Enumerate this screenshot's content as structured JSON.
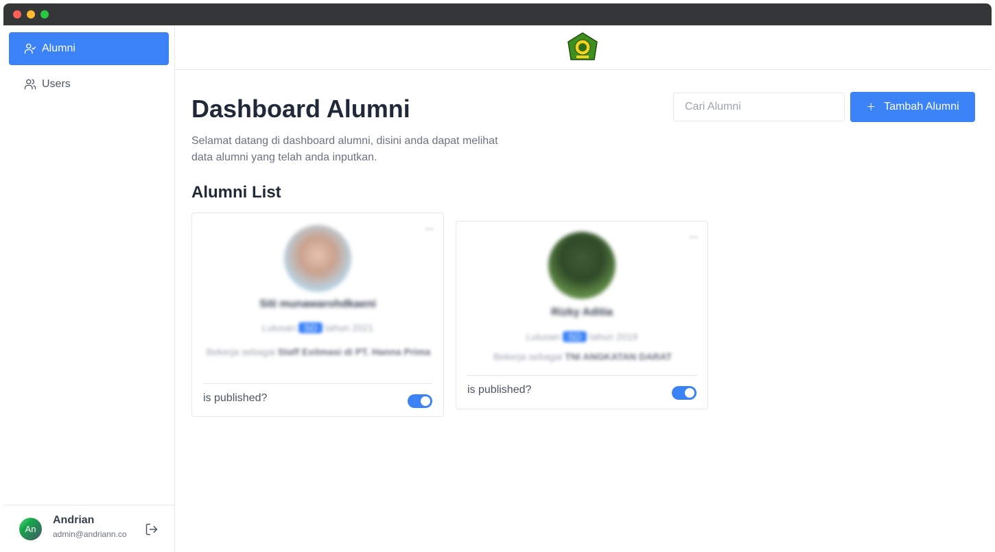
{
  "sidebar": {
    "items": [
      {
        "label": "Alumni",
        "icon": "user-check-icon",
        "active": true
      },
      {
        "label": "Users",
        "icon": "users-icon",
        "active": false
      }
    ],
    "profile": {
      "initials": "An",
      "name": "Andrian",
      "email": "admin@andriann.co"
    }
  },
  "header": {
    "logo": "school-emblem-logo"
  },
  "main": {
    "title": "Dashboard Alumni",
    "description": "Selamat datang di dashboard alumni, disini anda dapat melihat data alumni yang telah anda inputkan.",
    "search_placeholder": "Cari Alumni",
    "add_button_label": "Tambah Alumni",
    "section_title": "Alumni List"
  },
  "alumni": [
    {
      "name": "Siti munawarohdkaeni",
      "year_prefix": "Lulusan",
      "major": "SD",
      "year_suffix": "tahun 2021",
      "job_prefix": "Bekerja sebagai",
      "job": "Staff Exitmasi di PT. Hanna Prima",
      "published_label": "is published?",
      "published": true
    },
    {
      "name": "Rizky Aditia",
      "year_prefix": "Lulusan",
      "major": "SD",
      "year_suffix": "tahun 2019",
      "job_prefix": "Bekerja sebagai",
      "job": "TNI ANGKATAN DARAT",
      "published_label": "is published?",
      "published": true
    }
  ],
  "colors": {
    "accent": "#3b82f6",
    "titlebar": "#353638"
  }
}
